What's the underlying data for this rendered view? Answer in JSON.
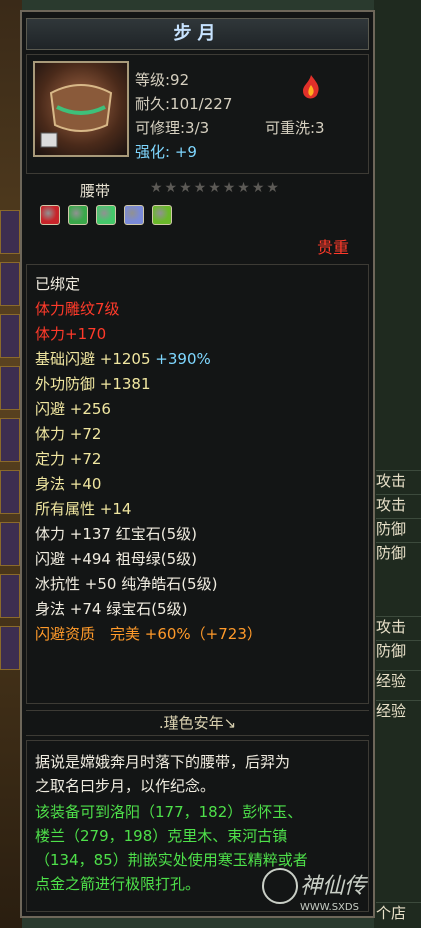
{
  "tooltip": {
    "title": "步月",
    "level": "等级:92",
    "durability": "耐久:101/227",
    "repairable": "可修理:3/3",
    "rewashable": "可重洗:3",
    "enhance_label": "强化:",
    "enhance_value": "+9",
    "item_type": "腰带",
    "stars": "★★★★★★★★★",
    "rarity": "贵重",
    "gem_colors": [
      "#c8242a",
      "#3aa84a",
      "#44c86a",
      "#7a8ad8",
      "#6ab82a"
    ],
    "attributes": [
      {
        "text": "已绑定",
        "color": "white"
      },
      {
        "text": "体力雕纹7级",
        "color": "red"
      },
      {
        "text": "体力+170",
        "color": "red"
      },
      {
        "text": "基础闪避 +1205",
        "extra": "+390%",
        "color": "yellow"
      },
      {
        "text": "外功防御 +1381",
        "color": "yellow"
      },
      {
        "text": "闪避 +256",
        "color": "yellow"
      },
      {
        "text": "体力 +72",
        "color": "yellow"
      },
      {
        "text": "定力 +72",
        "color": "yellow"
      },
      {
        "text": "身法 +40",
        "color": "yellow"
      },
      {
        "text": "所有属性 +14",
        "color": "yellow"
      },
      {
        "text": "体力 +137 红宝石(5级)",
        "color": "white"
      },
      {
        "text": "闪避 +494 祖母绿(5级)",
        "color": "white"
      },
      {
        "text": "冰抗性 +50 纯净皓石(5级)",
        "color": "white"
      },
      {
        "text": "身法 +74 绿宝石(5级)",
        "color": "white"
      },
      {
        "text": "闪避资质　完美 +60%（+723）",
        "color": "orange"
      }
    ],
    "set_name": ".瑾色安年↘",
    "description": [
      {
        "text": "据说是嫦娥奔月时落下的腰带，后羿为",
        "color": "white"
      },
      {
        "text": "之取名曰步月，以作纪念。",
        "color": "white"
      },
      {
        "text": "该装备可到洛阳（177，182）彭怀玉、",
        "color": "green"
      },
      {
        "text": "楼兰（279，198）克里木、束河古镇",
        "color": "green"
      },
      {
        "text": "（134，85）荆嵌实处使用寒玉精粹或者",
        "color": "green"
      },
      {
        "text": "点金之箭进行极限打孔。",
        "color": "green"
      }
    ]
  },
  "background": {
    "right_labels": [
      "攻击",
      "攻击",
      "防御",
      "防御",
      "攻击",
      "防御",
      "经验",
      "经验"
    ],
    "store_label": "个店"
  },
  "watermark": {
    "text": "神仙传",
    "url": "WWW.SXDS"
  }
}
